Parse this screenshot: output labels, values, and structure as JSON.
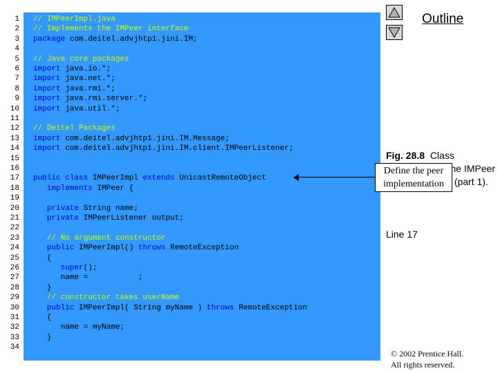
{
  "outline": {
    "title": "Outline"
  },
  "caption": {
    "fig_label": "Fig. 28.8",
    "fig_text": "Class IMPeerImpl is the IMPeer implementation (part 1).",
    "line_ref": "Line 17"
  },
  "callout": {
    "text": "Define the peer implementation"
  },
  "copyright": {
    "line1": "© 2002 Prentice Hall.",
    "line2": "All rights reserved."
  },
  "colors": {
    "panel": "#3399ff",
    "comment": "#c9ff00",
    "keyword": "#0000cc"
  },
  "icons": {
    "nav_up": "up-triangle-icon",
    "nav_down": "down-triangle-icon"
  },
  "code_lines": [
    {
      "num": "1",
      "parts": [
        {
          "t": "// IMPeerImpl.java",
          "k": "comment"
        }
      ]
    },
    {
      "num": "2",
      "parts": [
        {
          "t": "// Implements the IMPeer interface",
          "k": "comment"
        }
      ]
    },
    {
      "num": "3",
      "parts": [
        {
          "t": "package",
          "k": "keyword"
        },
        {
          "t": " com.deitel.advjhtp1.jini.IM;",
          "k": "plain"
        }
      ]
    },
    {
      "num": "4",
      "parts": []
    },
    {
      "num": "5",
      "parts": [
        {
          "t": "// Java core packages",
          "k": "comment"
        }
      ]
    },
    {
      "num": "6",
      "parts": [
        {
          "t": "import",
          "k": "keyword"
        },
        {
          "t": " java.io.*;",
          "k": "plain"
        }
      ]
    },
    {
      "num": "7",
      "parts": [
        {
          "t": "import",
          "k": "keyword"
        },
        {
          "t": " java.net.*;",
          "k": "plain"
        }
      ]
    },
    {
      "num": "8",
      "parts": [
        {
          "t": "import",
          "k": "keyword"
        },
        {
          "t": " java.rmi.*;",
          "k": "plain"
        }
      ]
    },
    {
      "num": "9",
      "parts": [
        {
          "t": "import",
          "k": "keyword"
        },
        {
          "t": " java.rmi.server.*;",
          "k": "plain"
        }
      ]
    },
    {
      "num": "10",
      "parts": [
        {
          "t": "import",
          "k": "keyword"
        },
        {
          "t": " java.util.*;",
          "k": "plain"
        }
      ]
    },
    {
      "num": "11",
      "parts": []
    },
    {
      "num": "12",
      "parts": [
        {
          "t": "// Deitel Packages",
          "k": "comment"
        }
      ]
    },
    {
      "num": "13",
      "parts": [
        {
          "t": "import",
          "k": "keyword"
        },
        {
          "t": " com.deitel.advjhtp1.jini.IM.Message;",
          "k": "plain"
        }
      ]
    },
    {
      "num": "14",
      "parts": [
        {
          "t": "import",
          "k": "keyword"
        },
        {
          "t": " com.deitel.advjhtp1.jini.IM.client.IMPeerListener;",
          "k": "plain"
        }
      ]
    },
    {
      "num": "15",
      "parts": []
    },
    {
      "num": "16",
      "parts": []
    },
    {
      "num": "17",
      "parts": [
        {
          "t": "public class",
          "k": "keyword"
        },
        {
          "t": " IMPeerImpl ",
          "k": "plain"
        },
        {
          "t": "extends",
          "k": "keyword"
        },
        {
          "t": " UnicastRemoteObject",
          "k": "plain"
        }
      ]
    },
    {
      "num": "18",
      "parts": [
        {
          "t": "   implements",
          "k": "keyword"
        },
        {
          "t": " IMPeer {",
          "k": "plain"
        }
      ]
    },
    {
      "num": "19",
      "parts": []
    },
    {
      "num": "20",
      "parts": [
        {
          "t": "   private",
          "k": "keyword"
        },
        {
          "t": " String name;",
          "k": "plain"
        }
      ]
    },
    {
      "num": "21",
      "parts": [
        {
          "t": "   private",
          "k": "keyword"
        },
        {
          "t": " IMPeerListener output;",
          "k": "plain"
        }
      ]
    },
    {
      "num": "22",
      "parts": []
    },
    {
      "num": "23",
      "parts": [
        {
          "t": "   // No argument constructor",
          "k": "comment"
        }
      ]
    },
    {
      "num": "24",
      "parts": [
        {
          "t": "   public",
          "k": "keyword"
        },
        {
          "t": " IMPeerImpl() ",
          "k": "plain"
        },
        {
          "t": "throws",
          "k": "keyword"
        },
        {
          "t": " RemoteException",
          "k": "plain"
        }
      ]
    },
    {
      "num": "25",
      "parts": [
        {
          "t": "   {",
          "k": "plain"
        }
      ]
    },
    {
      "num": "26",
      "parts": [
        {
          "t": "      super",
          "k": "keyword"
        },
        {
          "t": "();",
          "k": "plain"
        }
      ]
    },
    {
      "num": "27",
      "parts": [
        {
          "t": "      name =           ;",
          "k": "plain"
        }
      ]
    },
    {
      "num": "28",
      "parts": [
        {
          "t": "   }",
          "k": "plain"
        }
      ]
    },
    {
      "num": "29",
      "parts": [
        {
          "t": "   // constructor takes userName",
          "k": "comment"
        }
      ]
    },
    {
      "num": "30",
      "parts": [
        {
          "t": "   public",
          "k": "keyword"
        },
        {
          "t": " IMPeerImpl( String myName ) ",
          "k": "plain"
        },
        {
          "t": "throws",
          "k": "keyword"
        },
        {
          "t": " RemoteException",
          "k": "plain"
        }
      ]
    },
    {
      "num": "31",
      "parts": [
        {
          "t": "   {",
          "k": "plain"
        }
      ]
    },
    {
      "num": "32",
      "parts": [
        {
          "t": "      name = myName;",
          "k": "plain"
        }
      ]
    },
    {
      "num": "33",
      "parts": [
        {
          "t": "   }",
          "k": "plain"
        }
      ]
    },
    {
      "num": "34",
      "parts": []
    }
  ]
}
